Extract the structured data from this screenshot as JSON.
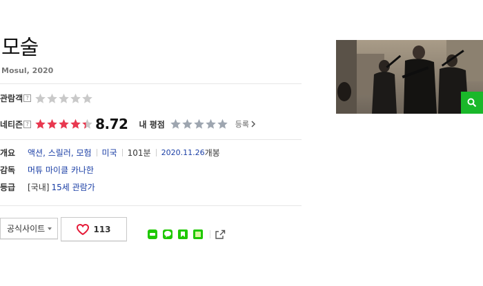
{
  "movie": {
    "title": "모술",
    "original_title_year": "Mosul, 2020"
  },
  "ratings": {
    "audience_label": "관람객",
    "audience_help": "?",
    "audience_stars_filled": 0,
    "netizen_label": "네티즌",
    "netizen_help": "?",
    "netizen_score": "8.72",
    "netizen_stars_filled": 4.36,
    "my_rating_label": "내 평점",
    "my_rating_stars_filled": 0,
    "register_label": "등록"
  },
  "info": {
    "overview_label": "개요",
    "genres": "액션, 스릴러, 모험",
    "country": "미국",
    "runtime": "101분",
    "release_date": "2020.11.26",
    "release_suffix": "개봉",
    "director_label": "감독",
    "director": "머튜 마이클 카나한",
    "grade_label": "등급",
    "grade_prefix": "[국내]",
    "grade": "15세 관람가"
  },
  "actions": {
    "official_site_label": "공식사이트",
    "like_count": "113"
  },
  "share": {
    "icons": [
      "band-icon",
      "kakao-icon",
      "blog-icon",
      "cafe-icon"
    ]
  },
  "colors": {
    "star_filled": "#e8384f",
    "star_empty": "#c9c9c9",
    "star_myrating": "#9ea6b0",
    "link": "#1a3ea5",
    "heart": "#e51937",
    "search_bg": "#1ab82a"
  }
}
